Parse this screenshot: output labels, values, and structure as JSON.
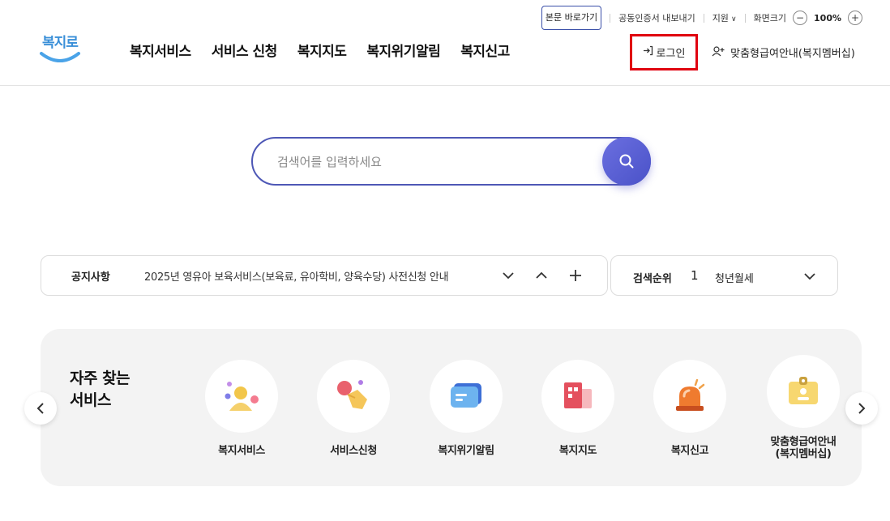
{
  "util": {
    "skip": "본문 바로가기",
    "cert": "공동인증서 내보내기",
    "lang": "지원",
    "zoom_label": "화면크기",
    "zoom_value": "100%"
  },
  "header": {
    "logo": "복지로",
    "nav": [
      "복지서비스",
      "서비스 신청",
      "복지지도",
      "복지위기알림",
      "복지신고"
    ],
    "login": "로그인",
    "member": "맞춤형급여안내(복지멤버십)"
  },
  "search": {
    "placeholder": "검색어를 입력하세요"
  },
  "notice": {
    "label": "공지사항",
    "text": "2025년 영유아 보육서비스(보육료, 유아학비, 양육수당) 사전신청 안내"
  },
  "rank": {
    "label": "검색순위",
    "num": "1",
    "word": "청년월세"
  },
  "freq": {
    "title_line1": "자주 찾는",
    "title_line2": "서비스",
    "items": [
      {
        "label": "복지서비스",
        "icon": "person-icon"
      },
      {
        "label": "서비스신청",
        "icon": "hand-icon"
      },
      {
        "label": "복지위기알림",
        "icon": "message-icon"
      },
      {
        "label": "복지지도",
        "icon": "map-icon"
      },
      {
        "label": "복지신고",
        "icon": "siren-icon"
      },
      {
        "label": "맞춤형급여안내\n(복지멤버십)",
        "icon": "badge-icon"
      }
    ]
  },
  "colors": {
    "accent": "#4e58b6",
    "login_highlight": "#e0000f",
    "panel_bg": "#f3f3f3"
  }
}
